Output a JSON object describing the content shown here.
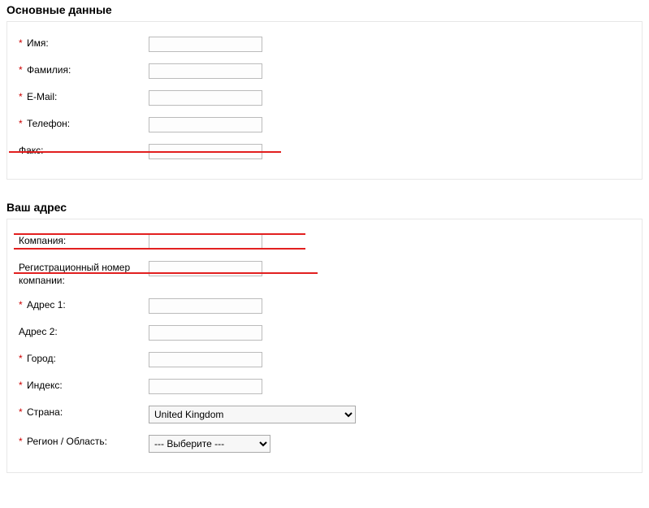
{
  "section_main": {
    "heading": "Основные данные",
    "name_label": "Имя:",
    "surname_label": "Фамилия:",
    "email_label": "E-Mail:",
    "phone_label": "Телефон:",
    "fax_label": "Факс:"
  },
  "section_address": {
    "heading": "Ваш адрес",
    "company_label": "Компания:",
    "company_reg_label": "Регистрационный номер компании:",
    "address1_label": "Адрес 1:",
    "address2_label": "Адрес 2:",
    "city_label": "Город:",
    "postcode_label": "Индекс:",
    "country_label": "Страна:",
    "country_value": "United Kingdom",
    "region_label": "Регион / Область:",
    "region_value": "--- Выберите ---"
  },
  "required_marker": "*"
}
